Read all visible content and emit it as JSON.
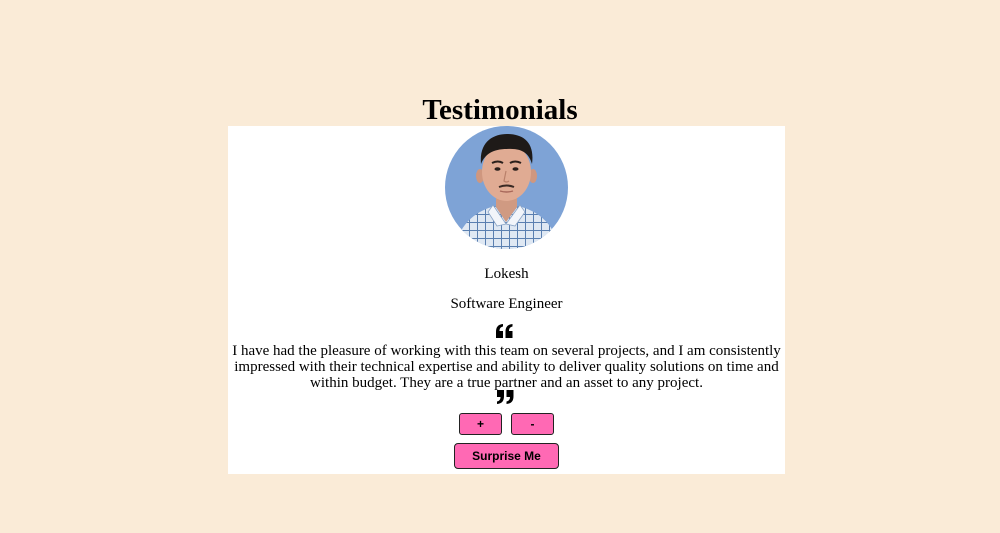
{
  "page": {
    "heading": "Testimonials"
  },
  "testimonial": {
    "avatar_icon": "person-avatar-photo",
    "name": "Lokesh",
    "role": "Software Engineer",
    "quote": "I have had the pleasure of working with this team on several projects, and I am consistently impressed with their technical expertise and ability to deliver quality solutions on time and within budget. They are a true partner and an asset to any project."
  },
  "controls": {
    "increment_label": "+",
    "decrement_label": "-",
    "surprise_label": "Surprise Me"
  },
  "colors": {
    "page_background": "#faebd7",
    "card_background": "#ffffff",
    "button_color": "#ff69b4"
  }
}
